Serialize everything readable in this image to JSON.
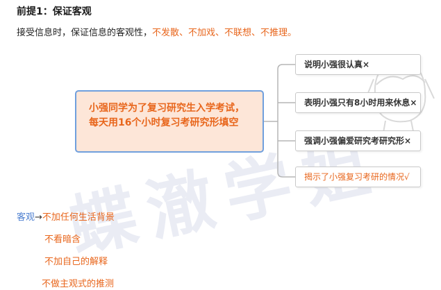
{
  "heading": "前提1：保证客观",
  "intro": {
    "prefix": "接受信息时，保证信息的客观性，",
    "highlight": "不发散、不加戏、不联想、不推理。"
  },
  "mindmap": {
    "center": "小强同学为了复习研究生入学考试，每天用16个小时复习考研究形填空",
    "branches": [
      "说明小强很认真×",
      "表明小强只有8小时用来休息×",
      "强调小强偏爱研究考研究形×",
      "揭示了小强复习考研的情况√"
    ]
  },
  "watermark": "蝶澈学姐",
  "list": {
    "lead_label": "客观",
    "arrow": "→",
    "first": "不加任何生活背景",
    "items": [
      "不看暗含",
      "不加自己的解释",
      "不做主观式的推测"
    ]
  },
  "colors": {
    "accent_orange": "#e8661c",
    "accent_blue": "#4d7fd0",
    "center_fill": "#fde6d8",
    "center_border": "#6f9fdd"
  }
}
